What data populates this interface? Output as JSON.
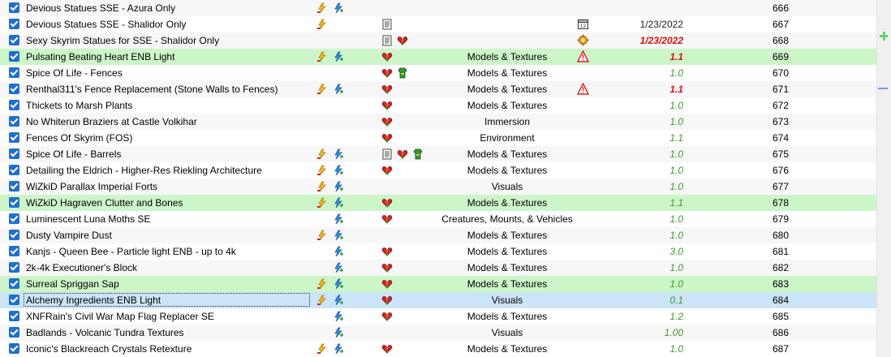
{
  "rows": [
    {
      "name": "Devious Statues SSE - Azura Only",
      "conflict": true,
      "lightning": true,
      "doc": false,
      "heart": false,
      "extra": "",
      "category": "",
      "warn": false,
      "version": "",
      "version_style": "",
      "priority": "666",
      "style": "alt"
    },
    {
      "name": "Devious Statues SSE - Shalidor Only",
      "conflict": true,
      "lightning": false,
      "doc": true,
      "heart": false,
      "extra": "",
      "category": "",
      "warn": "calendar",
      "version": "1/23/2022",
      "version_style": "plain",
      "priority": "667",
      "style": ""
    },
    {
      "name": "Sexy Skyrim Statues for SSE - Shalidor Only",
      "conflict": false,
      "lightning": false,
      "doc": true,
      "heart": true,
      "extra": "",
      "category": "",
      "warn": "gear",
      "version": "1/23/2022",
      "version_style": "red",
      "priority": "668",
      "style": "alt"
    },
    {
      "name": "Pulsating Beating Heart ENB Light",
      "conflict": true,
      "lightning": true,
      "doc": false,
      "heart": true,
      "extra": "",
      "category": "Models & Textures",
      "warn": "triangle",
      "version": "1.1",
      "version_style": "red",
      "priority": "669",
      "style": "hl"
    },
    {
      "name": "Spice Of Life - Fences",
      "conflict": false,
      "lightning": false,
      "doc": false,
      "heart": true,
      "extra": "armor",
      "category": "Models & Textures",
      "warn": false,
      "version": "1.0",
      "version_style": "green",
      "priority": "670",
      "style": ""
    },
    {
      "name": "Renthal311's Fence Replacement (Stone Walls to Fences)",
      "conflict": true,
      "lightning": true,
      "doc": false,
      "heart": true,
      "extra": "",
      "category": "Models & Textures",
      "warn": "triangle",
      "version": "1.1",
      "version_style": "red",
      "priority": "671",
      "style": "alt"
    },
    {
      "name": "Thickets to Marsh Plants",
      "conflict": false,
      "lightning": false,
      "doc": false,
      "heart": true,
      "extra": "",
      "category": "Models & Textures",
      "warn": false,
      "version": "1.0",
      "version_style": "green",
      "priority": "672",
      "style": ""
    },
    {
      "name": "No Whiterun Braziers at Castle Volkihar",
      "conflict": false,
      "lightning": false,
      "doc": false,
      "heart": true,
      "extra": "",
      "category": "Immersion",
      "warn": false,
      "version": "1.0",
      "version_style": "green",
      "priority": "673",
      "style": "alt"
    },
    {
      "name": "Fences Of Skyrim (FOS)",
      "conflict": false,
      "lightning": false,
      "doc": false,
      "heart": true,
      "extra": "",
      "category": "Environment",
      "warn": false,
      "version": "1.1",
      "version_style": "green",
      "priority": "674",
      "style": ""
    },
    {
      "name": "Spice Of Life - Barrels",
      "conflict": true,
      "lightning": true,
      "doc": true,
      "heart": true,
      "extra": "armor",
      "category": "Models & Textures",
      "warn": false,
      "version": "1.0",
      "version_style": "green",
      "priority": "675",
      "style": "alt"
    },
    {
      "name": "Detailing the Eldrich - Higher-Res Riekling Architecture",
      "conflict": true,
      "lightning": true,
      "doc": false,
      "heart": true,
      "extra": "",
      "category": "Models & Textures",
      "warn": false,
      "version": "1.0",
      "version_style": "green",
      "priority": "676",
      "style": ""
    },
    {
      "name": "WiZkiD Parallax Imperial Forts",
      "conflict": true,
      "lightning": true,
      "doc": false,
      "heart": false,
      "extra": "",
      "category": "Visuals",
      "warn": false,
      "version": "1.0",
      "version_style": "green",
      "priority": "677",
      "style": "alt"
    },
    {
      "name": "WiZkiD Hagraven Clutter and Bones",
      "conflict": true,
      "lightning": true,
      "doc": false,
      "heart": true,
      "extra": "",
      "category": "Models & Textures",
      "warn": false,
      "version": "1.1",
      "version_style": "green",
      "priority": "678",
      "style": "hl"
    },
    {
      "name": "Luminescent Luna Moths SE",
      "conflict": false,
      "lightning": true,
      "doc": false,
      "heart": true,
      "extra": "",
      "category": "Creatures, Mounts, & Vehicles",
      "warn": false,
      "version": "1.0",
      "version_style": "green",
      "priority": "679",
      "style": ""
    },
    {
      "name": "Dusty Vampire Dust",
      "conflict": true,
      "lightning": true,
      "doc": false,
      "heart": false,
      "extra": "",
      "category": "Models & Textures",
      "warn": false,
      "version": "1.0",
      "version_style": "green",
      "priority": "680",
      "style": "alt"
    },
    {
      "name": "Kanjs - Queen Bee - Particle light ENB - up to 4k",
      "conflict": false,
      "lightning": true,
      "doc": false,
      "heart": true,
      "extra": "",
      "category": "Models & Textures",
      "warn": false,
      "version": "3.0",
      "version_style": "green",
      "priority": "681",
      "style": ""
    },
    {
      "name": "2k-4k Executioner's Block",
      "conflict": false,
      "lightning": true,
      "doc": false,
      "heart": true,
      "extra": "",
      "category": "Models & Textures",
      "warn": false,
      "version": "1.0",
      "version_style": "green",
      "priority": "682",
      "style": "alt"
    },
    {
      "name": "Surreal Spriggan Sap",
      "conflict": true,
      "lightning": true,
      "doc": false,
      "heart": true,
      "extra": "",
      "category": "Models & Textures",
      "warn": false,
      "version": "1.0",
      "version_style": "green",
      "priority": "683",
      "style": "hl"
    },
    {
      "name": "Alchemy Ingredients ENB Light",
      "conflict": true,
      "lightning": true,
      "doc": false,
      "heart": true,
      "extra": "",
      "category": "Visuals",
      "warn": false,
      "version": "0.1",
      "version_style": "green",
      "priority": "684",
      "style": "sel"
    },
    {
      "name": "XNFRain's Civil War Map Flag Replacer SE",
      "conflict": false,
      "lightning": true,
      "doc": false,
      "heart": true,
      "extra": "",
      "category": "Models & Textures",
      "warn": false,
      "version": "1.2",
      "version_style": "green",
      "priority": "685",
      "style": ""
    },
    {
      "name": "Badlands - Volcanic Tundra Textures",
      "conflict": false,
      "lightning": true,
      "doc": false,
      "heart": false,
      "extra": "",
      "category": "Visuals",
      "warn": false,
      "version": "1.00",
      "version_style": "green",
      "priority": "686",
      "style": "alt"
    },
    {
      "name": "Iconic's Blackreach Crystals Retexture",
      "conflict": true,
      "lightning": true,
      "doc": false,
      "heart": true,
      "extra": "",
      "category": "Models & Textures",
      "warn": false,
      "version": "1.0",
      "version_style": "green",
      "priority": "687",
      "style": ""
    }
  ],
  "colors": {
    "accent_check": "#1f6fcf",
    "row_highlight": "#cdf6c8",
    "row_selected": "#cce4f7",
    "version_green": "#3d9a2a",
    "version_red": "#e01010"
  },
  "icons": {
    "conflict": "conflict-flag-icon",
    "lightning": "lightning-flag-icon",
    "doc": "document-icon",
    "heart": "heart-icon",
    "armor": "armor-icon",
    "calendar": "calendar-icon",
    "gear": "gear-icon",
    "triangle": "warning-triangle-icon"
  }
}
